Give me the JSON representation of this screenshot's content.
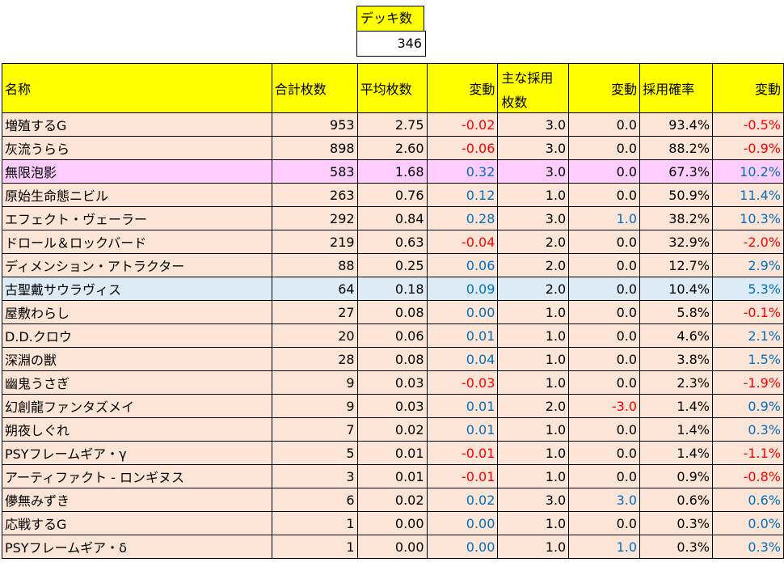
{
  "deck": {
    "label": "デッキ数",
    "value": "346"
  },
  "headers": {
    "name": "名称",
    "total": "合計枚数",
    "avg": "平均枚数",
    "change1": "変動",
    "main_line1": "主な採用",
    "main_line2": "枚数",
    "change2": "変動",
    "rate": "採用確率",
    "change3": "変動"
  },
  "rows": [
    {
      "name": "増殖するG",
      "total": "953",
      "avg": "2.75",
      "d1": "-0.02",
      "main": "3.0",
      "d2": "0.0",
      "rate": "93.4%",
      "d3": "-0.5%",
      "bg": "peach"
    },
    {
      "name": "灰流うらら",
      "total": "898",
      "avg": "2.60",
      "d1": "-0.06",
      "main": "3.0",
      "d2": "0.0",
      "rate": "88.2%",
      "d3": "-0.9%",
      "bg": "peach"
    },
    {
      "name": "無限泡影",
      "total": "583",
      "avg": "1.68",
      "d1": "0.32",
      "main": "3.0",
      "d2": "0.0",
      "rate": "67.3%",
      "d3": "10.2%",
      "bg": "pink"
    },
    {
      "name": "原始生命態ニビル",
      "total": "263",
      "avg": "0.76",
      "d1": "0.12",
      "main": "1.0",
      "d2": "0.0",
      "rate": "50.9%",
      "d3": "11.4%",
      "bg": "peach"
    },
    {
      "name": "エフェクト・ヴェーラー",
      "total": "292",
      "avg": "0.84",
      "d1": "0.28",
      "main": "3.0",
      "d2": "1.0",
      "rate": "38.2%",
      "d3": "10.3%",
      "bg": "peach"
    },
    {
      "name": "ドロール＆ロックバード",
      "total": "219",
      "avg": "0.63",
      "d1": "-0.04",
      "main": "2.0",
      "d2": "0.0",
      "rate": "32.9%",
      "d3": "-2.0%",
      "bg": "peach"
    },
    {
      "name": "ディメンション・アトラクター",
      "total": "88",
      "avg": "0.25",
      "d1": "0.06",
      "main": "2.0",
      "d2": "0.0",
      "rate": "12.7%",
      "d3": "2.9%",
      "bg": "peach"
    },
    {
      "name": "古聖戴サウラヴィス",
      "total": "64",
      "avg": "0.18",
      "d1": "0.09",
      "main": "2.0",
      "d2": "0.0",
      "rate": "10.4%",
      "d3": "5.3%",
      "bg": "blue"
    },
    {
      "name": "屋敷わらし",
      "total": "27",
      "avg": "0.08",
      "d1": "0.00",
      "main": "1.0",
      "d2": "0.0",
      "rate": "5.8%",
      "d3": "-0.1%",
      "bg": "peach"
    },
    {
      "name": "D.D.クロウ",
      "total": "20",
      "avg": "0.06",
      "d1": "0.01",
      "main": "1.0",
      "d2": "0.0",
      "rate": "4.6%",
      "d3": "2.1%",
      "bg": "peach"
    },
    {
      "name": "深淵の獣",
      "total": "28",
      "avg": "0.08",
      "d1": "0.04",
      "main": "1.0",
      "d2": "0.0",
      "rate": "3.8%",
      "d3": "1.5%",
      "bg": "peach"
    },
    {
      "name": "幽鬼うさぎ",
      "total": "9",
      "avg": "0.03",
      "d1": "-0.03",
      "main": "1.0",
      "d2": "0.0",
      "rate": "2.3%",
      "d3": "-1.9%",
      "bg": "peach"
    },
    {
      "name": "幻創龍ファンタズメイ",
      "total": "9",
      "avg": "0.03",
      "d1": "0.01",
      "main": "2.0",
      "d2": "-3.0",
      "rate": "1.4%",
      "d3": "0.9%",
      "bg": "peach"
    },
    {
      "name": "朔夜しぐれ",
      "total": "7",
      "avg": "0.02",
      "d1": "0.01",
      "main": "1.0",
      "d2": "0.0",
      "rate": "1.4%",
      "d3": "0.3%",
      "bg": "peach"
    },
    {
      "name": "PSYフレームギア・γ",
      "total": "5",
      "avg": "0.01",
      "d1": "-0.01",
      "main": "1.0",
      "d2": "0.0",
      "rate": "1.4%",
      "d3": "-1.1%",
      "bg": "peach"
    },
    {
      "name": "アーティファクト - ロンギヌス",
      "total": "3",
      "avg": "0.01",
      "d1": "-0.01",
      "main": "1.0",
      "d2": "0.0",
      "rate": "0.9%",
      "d3": "-0.8%",
      "bg": "peach"
    },
    {
      "name": "儚無みずき",
      "total": "6",
      "avg": "0.02",
      "d1": "0.02",
      "main": "3.0",
      "d2": "3.0",
      "rate": "0.6%",
      "d3": "0.6%",
      "bg": "peach"
    },
    {
      "name": "応戦するG",
      "total": "1",
      "avg": "0.00",
      "d1": "0.00",
      "main": "1.0",
      "d2": "0.0",
      "rate": "0.3%",
      "d3": "0.0%",
      "bg": "peach"
    },
    {
      "name": "PSYフレームギア・δ",
      "total": "1",
      "avg": "0.00",
      "d1": "0.00",
      "main": "1.0",
      "d2": "1.0",
      "rate": "0.3%",
      "d3": "0.3%",
      "bg": "peach"
    }
  ],
  "colors": {
    "header_bg": "#ffff00",
    "row_peach": "#fce4d6",
    "row_pink": "#ffccff",
    "row_blue": "#ddebf7",
    "negative_text": "#ff0000",
    "positive_text": "#0070c0"
  }
}
